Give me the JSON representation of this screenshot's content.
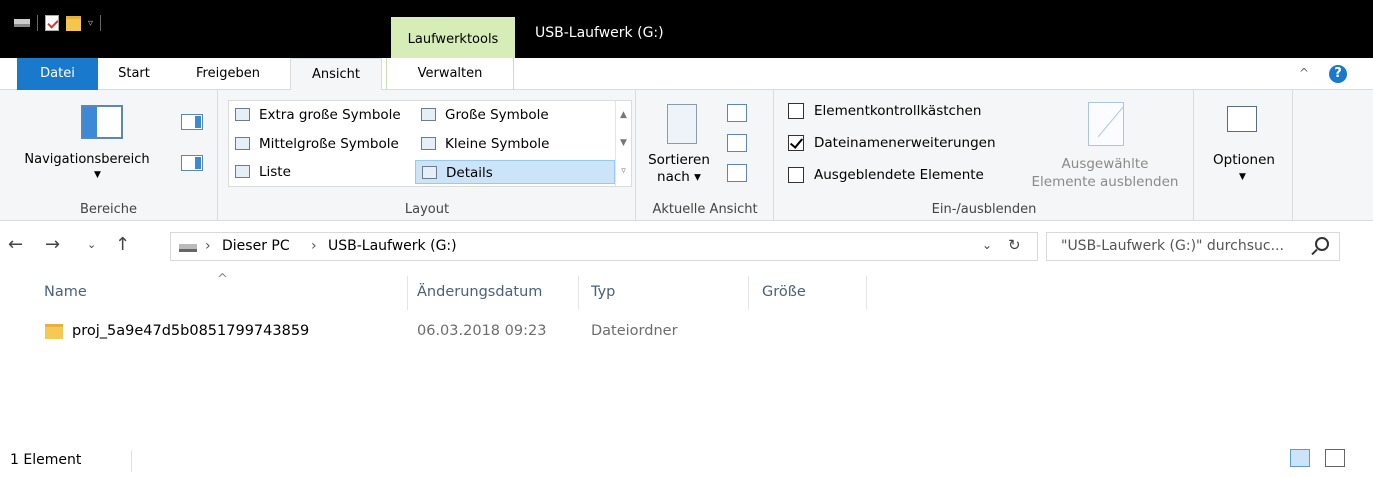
{
  "titlebar": {
    "context_tab": "Laufwerktools",
    "window_title": "USB-Laufwerk (G:)"
  },
  "ribbon_tabs": {
    "datei": "Datei",
    "start": "Start",
    "freigeben": "Freigeben",
    "ansicht": "Ansicht",
    "verwalten": "Verwalten",
    "help": "?"
  },
  "ribbon": {
    "bereiche": {
      "navpane": "Navigationsbereich",
      "label": "Bereiche"
    },
    "layout": {
      "extra_large": "Extra große Symbole",
      "large": "Große Symbole",
      "medium": "Mittelgroße Symbole",
      "small": "Kleine Symbole",
      "list": "Liste",
      "details": "Details",
      "label": "Layout"
    },
    "ansicht": {
      "sort_line1": "Sortieren",
      "sort_line2": "nach",
      "label": "Aktuelle Ansicht"
    },
    "einaus": {
      "item_checkboxes": "Elementkontrollkästchen",
      "item_checkboxes_checked": false,
      "extensions": "Dateinamenerweiterungen",
      "extensions_checked": true,
      "hidden": "Ausgeblendete Elemente",
      "hidden_checked": false,
      "hide_selected_line1": "Ausgewählte",
      "hide_selected_line2": "Elemente ausblenden",
      "label": "Ein-/ausblenden"
    },
    "optionen": {
      "label": "Optionen"
    }
  },
  "address": {
    "crumbs": [
      "Dieser PC",
      "USB-Laufwerk (G:)"
    ],
    "search_placeholder": "\"USB-Laufwerk (G:)\" durchsuc..."
  },
  "columns": {
    "name": "Name",
    "date": "Änderungsdatum",
    "type": "Typ",
    "size": "Größe"
  },
  "files": [
    {
      "name": "proj_5a9e47d5b0851799743859",
      "date": "06.03.2018 09:23",
      "type": "Dateiordner",
      "size": ""
    }
  ],
  "status": {
    "count": "1 Element"
  },
  "colors": {
    "accent": "#1979ca",
    "context_tab": "#d7edb8",
    "folder": "#f6c955",
    "selection": "#cce4f7"
  }
}
